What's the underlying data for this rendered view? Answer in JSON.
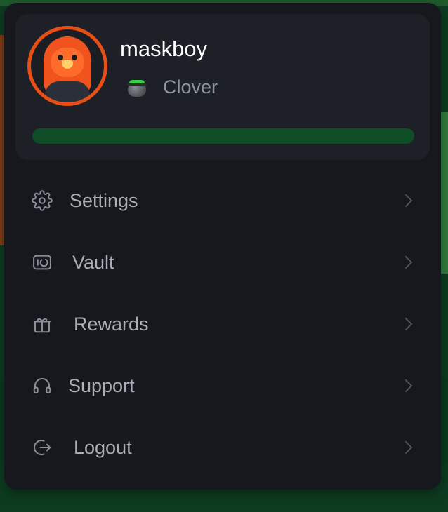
{
  "profile": {
    "username": "maskboy",
    "tier": {
      "label": "Clover",
      "icon": "cauldron-icon"
    },
    "progress": {
      "fraction": 0.0,
      "track_color": "#0f4d26"
    },
    "avatar_ring_color": "#e74f17"
  },
  "menu": {
    "items": [
      {
        "label": "Settings",
        "icon": "gear-icon"
      },
      {
        "label": "Vault",
        "icon": "vault-icon"
      },
      {
        "label": "Rewards",
        "icon": "gift-icon"
      },
      {
        "label": "Support",
        "icon": "headset-icon"
      },
      {
        "label": "Logout",
        "icon": "logout-icon"
      }
    ],
    "chevron_icon": "chevron-right-icon"
  },
  "colors": {
    "panel_bg": "#16181d",
    "card_bg": "#1d2027",
    "label_color": "#a8adb6",
    "tier_color": "#8e96a3"
  }
}
